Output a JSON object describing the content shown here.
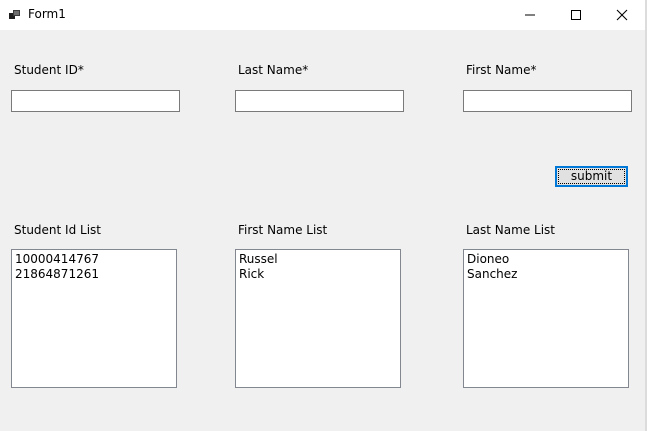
{
  "window": {
    "title": "Form1",
    "icons": {
      "app": "form-app-icon",
      "minimize": "minimize-icon",
      "maximize": "maximize-icon",
      "close": "close-icon"
    }
  },
  "form": {
    "student_id_label": "Student ID*",
    "last_name_label": "Last Name*",
    "first_name_label": "First Name*",
    "student_id_value": "",
    "last_name_value": "",
    "first_name_value": "",
    "submit_label": "submit"
  },
  "lists": {
    "student_id_list_label": "Student Id List",
    "first_name_list_label": "First Name List",
    "last_name_list_label": "Last Name List",
    "student_ids": [
      "10000414767",
      "21864871261"
    ],
    "first_names": [
      "Russel",
      "Rick"
    ],
    "last_names": [
      "Dioneo",
      "Sanchez"
    ]
  },
  "colors": {
    "window_bg": "#f0f0f0",
    "titlebar_bg": "#ffffff",
    "focus_border": "#0078d7"
  }
}
